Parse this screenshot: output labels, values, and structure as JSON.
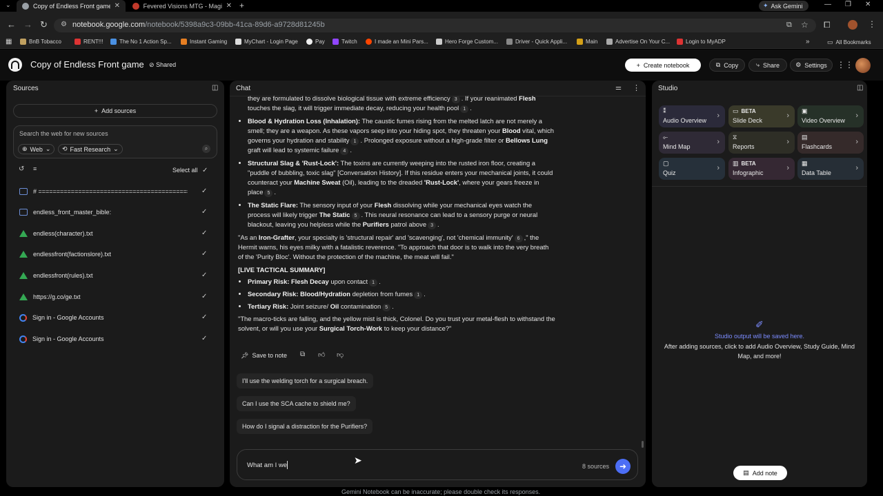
{
  "browser": {
    "tabs": [
      {
        "title": "Copy of Endless Front game - G",
        "active": true
      },
      {
        "title": "Fevered Visions MTG - Magic: T",
        "active": false
      }
    ],
    "ask_gemini": "Ask Gemini",
    "url": {
      "host": "notebook.google.com",
      "path": "/notebook/5398a9c3-09bb-41ca-89d6-a9728d81245b"
    },
    "bookmarks": [
      "BnB Tobacco",
      "RENT!!!",
      "The No 1 Action Sp...",
      "Instant Gaming",
      "MyChart - Login Page",
      "Pay",
      "Twitch",
      "I made an Mini Pars...",
      "Hero Forge Custom...",
      "Driver - Quick Appli...",
      "Main",
      "Advertise On Your C...",
      "Login to MyADP"
    ],
    "all_bookmarks": "All Bookmarks"
  },
  "header": {
    "title": "Copy of Endless Front game",
    "shared": "Shared",
    "create_notebook": "Create notebook",
    "copy": "Copy",
    "share": "Share",
    "settings": "Settings"
  },
  "sources": {
    "title": "Sources",
    "add_sources": "Add sources",
    "search_placeholder": "Search the web for new sources",
    "web": "Web",
    "fast_research": "Fast Research",
    "select_all": "Select all",
    "items": [
      "# ==========================================",
      "endless_front_master_bible:",
      "endless(character).txt",
      "endlessfront(factionslore).txt",
      "endlessfront(rules).txt",
      "https://g.co/ge.txt",
      "Sign in - Google Accounts",
      "Sign in - Google Accounts"
    ]
  },
  "chat": {
    "title": "Chat",
    "top_partial": "they are formulated to dissolve biological tissue with extreme efficiency",
    "top_partial_b": ". If your reanimated",
    "top_flesh": "Flesh",
    "top_line2": "touches the slag, it will trigger immediate decay, reducing your health pool",
    "b1_title": "Blood & Hydration Loss (Inhalation):",
    "b1_a": "The caustic fumes rising from the melted latch are not merely a smell; they are a weapon. As these vapors seep into your hiding spot, they threaten your",
    "b1_blood": "Blood",
    "b1_b": "vital, which governs your hydration and stability",
    "b1_c": ". Prolonged exposure without a high-grade filter or",
    "b1_bellows": "Bellows Lung",
    "b1_d": "graft will lead to systemic failure",
    "b2_title": "Structural Slag & 'Rust-Lock':",
    "b2_a": "The toxins are currently weeping into the rusted iron floor, creating a \"puddle of bubbling, toxic slag\" [Conversation History]. If this residue enters your mechanical joints, it could counteract your",
    "b2_sweat": "Machine Sweat",
    "b2_b": "(Oil), leading to the dreaded",
    "b2_rust": "'Rust-Lock'",
    "b2_c": ", where your gears freeze in place",
    "b3_title": "The Static Flare:",
    "b3_a": "The sensory input of your",
    "b3_flesh": "Flesh",
    "b3_b": "dissolving while your mechanical eyes watch the process will likely trigger",
    "b3_static": "The Static",
    "b3_c": ". This neural resonance can lead to a sensory purge or neural blackout, leaving you helpless while the",
    "b3_purifiers": "Purifiers",
    "b3_d": "patrol above",
    "quote_a": "\"As an",
    "quote_iron": "Iron-Grafter",
    "quote_b": ", your specialty is 'structural repair' and 'scavenging', not 'chemical immunity'",
    "quote_c": ",\" the Hermit warns, his eyes milky with a fatalistic reverence. \"To approach that door is to walk into the very breath of the 'Purity Bloc'. Without the protection of the machine, the meat will fail.\"",
    "summary_title": "[LIVE TACTICAL SUMMARY]",
    "s1_label": "Primary Risk: Flesh Decay",
    "s1_text": "upon contact",
    "s2_label": "Secondary Risk: Blood/Hydration",
    "s2_text": "depletion from fumes",
    "s3_label": "Tertiary Risk:",
    "s3_text": "Joint seizure/",
    "s3_oil": "Oil",
    "s3_text2": "contamination",
    "final_a": "\"The macro-ticks are falling, and the yellow mist is thick, Colonel. Do you trust your metal-flesh to withstand the solvent, or will you use your",
    "final_torch": "Surgical Torch-Work",
    "final_b": "to keep your distance?\"",
    "cites": {
      "c3": "3",
      "c1": "1",
      "c4": "4",
      "c5": "5",
      "c6": "6"
    },
    "save_to_note": "Save to note",
    "suggestions": [
      "I'll use the welding torch for a surgical breach.",
      "Can I use the SCA cache to shield me?",
      "How do I signal a distraction for the Purifiers?"
    ],
    "input_value": "What am I we",
    "sources_count": "8 sources",
    "disclaimer": "Gemini Notebook can be inaccurate; please double check its responses."
  },
  "studio": {
    "title": "Studio",
    "tiles": [
      {
        "label": "Audio Overview",
        "beta": ""
      },
      {
        "label": "Slide Deck",
        "beta": "BETA"
      },
      {
        "label": "Video Overview",
        "beta": ""
      },
      {
        "label": "Mind Map",
        "beta": ""
      },
      {
        "label": "Reports",
        "beta": ""
      },
      {
        "label": "Flashcards",
        "beta": ""
      },
      {
        "label": "Quiz",
        "beta": ""
      },
      {
        "label": "Infographic",
        "beta": "BETA"
      },
      {
        "label": "Data Table",
        "beta": ""
      }
    ],
    "empty_title": "Studio output will be saved here.",
    "empty_desc": "After adding sources, click to add Audio Overview, Study Guide, Mind Map, and more!",
    "add_note": "Add note"
  },
  "colors": {
    "accent": "#4c6ef5",
    "studio_link": "#7c8cff"
  }
}
